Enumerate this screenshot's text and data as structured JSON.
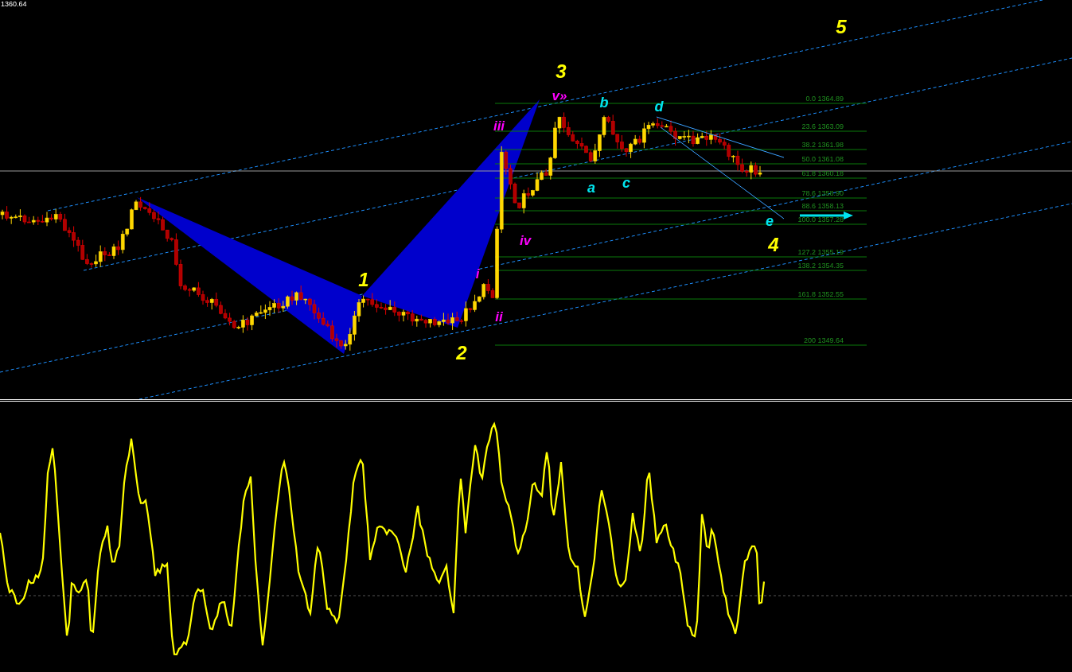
{
  "price_label": "1360.64",
  "fibonacci_levels": [
    {
      "label": "0.0 1364.89"
    },
    {
      "label": "23.6 1363.09"
    },
    {
      "label": "38.2 1361.98"
    },
    {
      "label": "50.0 1361.08"
    },
    {
      "label": "61.8 1360.18"
    },
    {
      "label": "78.6 1358.90"
    },
    {
      "label": "88.6 1358.13"
    },
    {
      "label": "100.0 1357.28"
    },
    {
      "label": "127.2 1355.19"
    },
    {
      "label": "138.2 1354.35"
    },
    {
      "label": "161.8 1352.55"
    },
    {
      "label": "200 1349.64"
    }
  ],
  "wave_labels": [
    {
      "text": "1",
      "kind": "primary"
    },
    {
      "text": "2",
      "kind": "primary"
    },
    {
      "text": "3",
      "kind": "primary"
    },
    {
      "text": "4",
      "kind": "primary"
    },
    {
      "text": "5",
      "kind": "primary"
    },
    {
      "text": "i",
      "kind": "minor"
    },
    {
      "text": "ii",
      "kind": "minor"
    },
    {
      "text": "iii",
      "kind": "minor"
    },
    {
      "text": "iv",
      "kind": "minor"
    },
    {
      "text": "v»",
      "kind": "minor"
    },
    {
      "text": "a",
      "kind": "corrective"
    },
    {
      "text": "b",
      "kind": "corrective"
    },
    {
      "text": "c",
      "kind": "corrective"
    },
    {
      "text": "d",
      "kind": "corrective"
    },
    {
      "text": "e",
      "kind": "corrective"
    }
  ]
}
